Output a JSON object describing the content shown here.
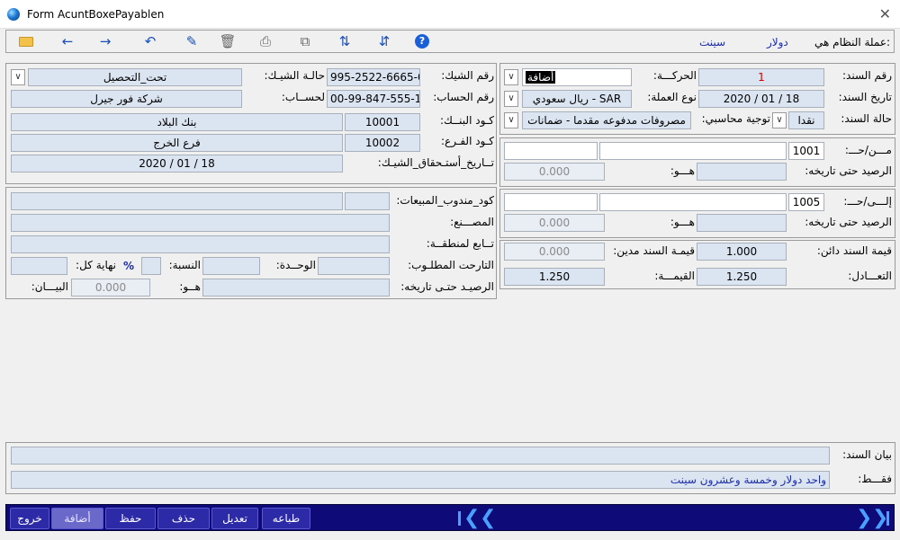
{
  "window": {
    "title": "Form AcuntBoxePayablen"
  },
  "toolbar": {
    "system_currency_label": "عملة النظام هي:",
    "currency_major": "دولار",
    "currency_minor": "سينت",
    "icons": [
      "folder-icon",
      "arrow-left-icon",
      "arrow-right-icon",
      "undo-icon",
      "edit-icon",
      "delete-icon",
      "print-icon",
      "copy-icon",
      "sort-asc-icon",
      "sort-desc-icon",
      "help-icon"
    ]
  },
  "voucher": {
    "number_label": "رقم السند:",
    "number": "1",
    "movement_label": "الحركـــة:",
    "movement": "أضافة",
    "date_label": "تاريخ السند:",
    "date": "2020 / 01 / 18",
    "currency_label": "نوع العملة:",
    "currency": "ريال سعودي - SAR",
    "status_label": "حالة السند:",
    "status": "نقدا",
    "accounting_label": "توجية محاسبي:",
    "accounting": "مصروفات مدفوعه مقدما - ضمانات"
  },
  "from_account": {
    "label": "مـــن/حـــ:",
    "code": "1001",
    "name": "",
    "balance_label": "الرصيد حتى تاريخه:",
    "type_label": "هـــو:",
    "balance": "0.000"
  },
  "to_account": {
    "label": "إلـــى/حـــ:",
    "code": "1005",
    "name": "",
    "balance_label": "الرصيد حتى تاريخه:",
    "type_label": "هـــو:",
    "balance": "0.000"
  },
  "values": {
    "credit_label": "قيمة السند دائن:",
    "credit": "1.000",
    "debit_label": "قيمـة السند مدين:",
    "debit": "0.000",
    "equivalent_label": "التعـــادل:",
    "equivalent": "1.250",
    "value_label": "القيمـــة:",
    "value": "1.250"
  },
  "cheque": {
    "number_label": "رقم الشيك:",
    "number": "995-2522-6665-0",
    "status_label": "حالـة الشيـك:",
    "status": "تحت_التحصيل",
    "account_label": "رقم الحساب:",
    "account": "00-99-847-555-1",
    "beneficiary_label": "لحســاب:",
    "beneficiary": "شركة فور جيرل",
    "bank_code_label": "كـود البنــك:",
    "bank_code": "10001",
    "bank_name": "بنك البلاد",
    "branch_code_label": "كـود الفـرع:",
    "branch_code": "10002",
    "branch_name": "فرع الخرج",
    "due_date_label": "تــاريخ_أستـحقاق_الشيـك:",
    "due_date": "2020 / 01 / 18"
  },
  "sales": {
    "rep_code_label": "كود_مندوب_المبيعات:",
    "factory_label": "المصـــنع:",
    "region_label": "تــابع لمنطقــة:",
    "required_date_label": "التارحت المطلـوب:",
    "unit_label": "الوحــدة:",
    "ratio_label": "النسبة:",
    "end_label": "نهاية كل:",
    "percent": "%",
    "balance_label": "الرصيـد حتـى تاريخه:",
    "type_label": "هــو:",
    "statement_label": "البيـــان:",
    "balance": "0.000"
  },
  "statement": {
    "label": "بيان السند:",
    "value": "",
    "only_label": "فقـــط:",
    "only_value": "واحد دولار وخمسة وعشرون سينت"
  },
  "bottom_buttons": {
    "print": "طباعه",
    "edit": "تعديل",
    "delete": "حذف",
    "save": "حفظ",
    "add": "أضافة",
    "exit": "خروج"
  }
}
